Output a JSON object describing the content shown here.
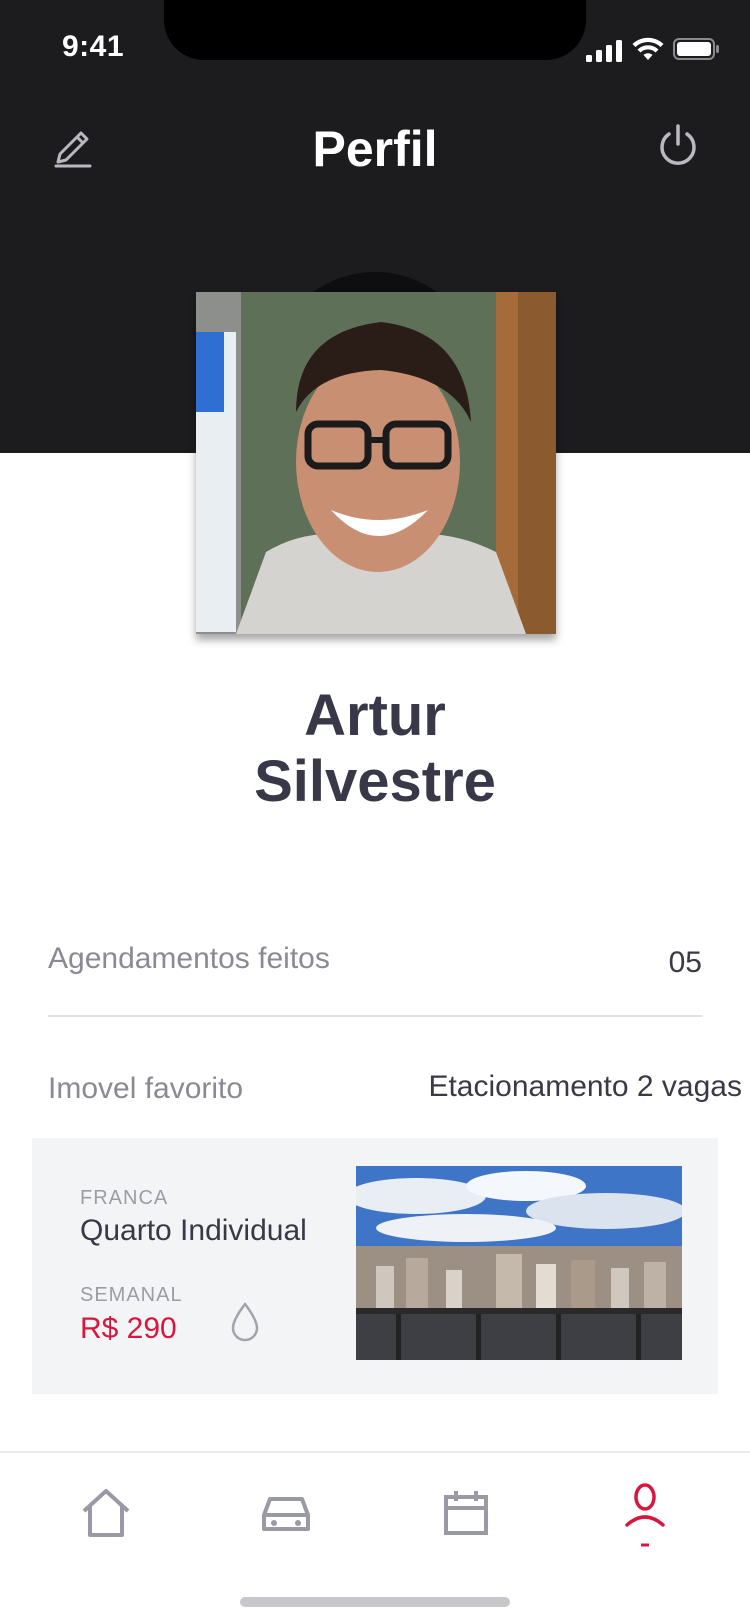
{
  "status": {
    "time": "9:41"
  },
  "nav": {
    "title": "Perfil"
  },
  "profile": {
    "first_name": "Artur",
    "last_name": "Silvestre"
  },
  "stats": {
    "bookings_label": "Agendamentos feitos",
    "bookings_value": "05",
    "favorite_label": "Imovel favorito",
    "favorite_value": "Etacionamento 2 vagas"
  },
  "card": {
    "city": "FRANCA",
    "title": "Quarto Individual",
    "period": "SEMANAL",
    "price": "R$ 290"
  },
  "tabs": [
    {
      "icon": "home-icon"
    },
    {
      "icon": "car-icon"
    },
    {
      "icon": "calendar-icon"
    },
    {
      "icon": "profile-icon",
      "active": true
    }
  ],
  "colors": {
    "accent": "#d8173e",
    "header": "#1c1c1f",
    "text_dark": "#393848",
    "icon_inactive": "#9a99a6"
  }
}
